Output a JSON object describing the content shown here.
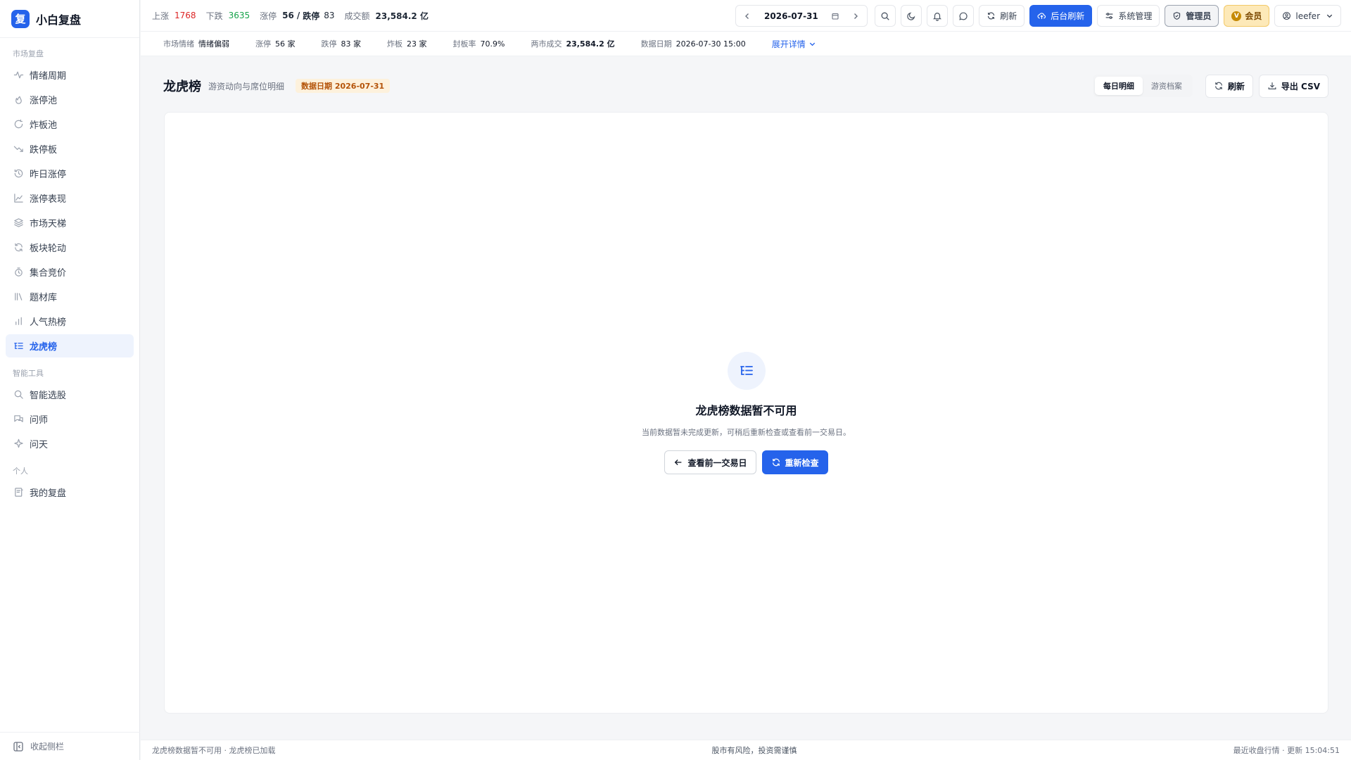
{
  "brand": {
    "logo_char": "复",
    "name": "小白复盘"
  },
  "sidebar": {
    "sections": [
      {
        "title": "市场复盘",
        "items": [
          {
            "label": "情绪周期",
            "icon": "activity-icon"
          },
          {
            "label": "涨停池",
            "icon": "flame-icon"
          },
          {
            "label": "炸板池",
            "icon": "circle-arrow-icon"
          },
          {
            "label": "跌停板",
            "icon": "trending-down-icon"
          },
          {
            "label": "昨日涨停",
            "icon": "history-icon"
          },
          {
            "label": "涨停表现",
            "icon": "area-chart-icon"
          },
          {
            "label": "市场天梯",
            "icon": "layers-icon"
          },
          {
            "label": "板块轮动",
            "icon": "refresh-icon"
          },
          {
            "label": "集合竞价",
            "icon": "timer-icon"
          },
          {
            "label": "题材库",
            "icon": "library-icon"
          },
          {
            "label": "人气热榜",
            "icon": "bar-chart-icon"
          },
          {
            "label": "龙虎榜",
            "icon": "list-tree-icon",
            "active": true
          }
        ]
      },
      {
        "title": "智能工具",
        "items": [
          {
            "label": "智能选股",
            "icon": "search-icon"
          },
          {
            "label": "问师",
            "icon": "chat-icon"
          },
          {
            "label": "问天",
            "icon": "sparkle-icon"
          }
        ]
      },
      {
        "title": "个人",
        "items": [
          {
            "label": "我的复盘",
            "icon": "notebook-icon"
          }
        ]
      }
    ],
    "collapse_label": "收起侧栏"
  },
  "topbar": {
    "up_label": "上涨",
    "up_value": "1768",
    "down_label": "下跌",
    "down_value": "3635",
    "limit_label": "涨停",
    "limit_value": "56",
    "limit_sep": "/",
    "limit_down_label": "跌停",
    "limit_down_value": "83",
    "turnover_label": "成交额",
    "turnover_value": "23,584.2 亿",
    "date": "2026-07-31",
    "refresh_label": "刷新",
    "bg_refresh_label": "后台刷新",
    "sys_label": "系统管理",
    "admin_label": "管理员",
    "vip_badge": "V",
    "vip_label": "会员",
    "user": "leefer"
  },
  "subbar": {
    "sentiment_label": "市场情绪",
    "sentiment_value": "情绪偏弱",
    "limit_label": "涨停",
    "limit_value": "56 家",
    "limit_down_label": "跌停",
    "limit_down_value": "83 家",
    "broken_label": "炸板",
    "broken_value": "23 家",
    "seal_label": "封板率",
    "seal_value": "70.9%",
    "market_label": "两市成交",
    "market_value": "23,584.2 亿",
    "data_date_label": "数据日期",
    "data_date_value": "2026-07-30 15:00",
    "expand_label": "展开详情"
  },
  "page": {
    "title": "龙虎榜",
    "subtitle": "游资动向与席位明细",
    "date_tag": "数据日期 2026-07-31",
    "seg_daily": "每日明细",
    "seg_archive": "游资档案",
    "refresh_label": "刷新",
    "export_label": "导出 CSV"
  },
  "empty": {
    "title": "龙虎榜数据暂不可用",
    "desc": "当前数据暂未完成更新，可稍后重新检查或查看前一交易日。",
    "prev_label": "查看前一交易日",
    "recheck_label": "重新检查"
  },
  "footer": {
    "left": "龙虎榜数据暂不可用 · 龙虎榜已加载",
    "center": "股市有风险，投资需谨慎",
    "right": "最近收盘行情 · 更新 15:04:51"
  }
}
